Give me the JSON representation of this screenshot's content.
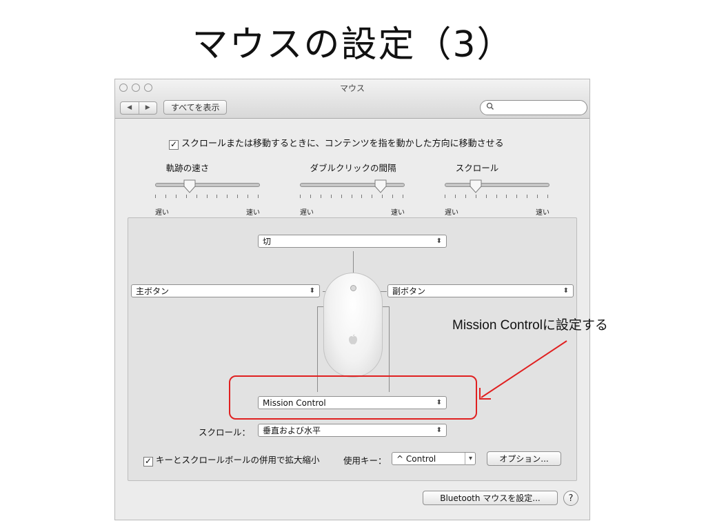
{
  "slide": {
    "title": "マウスの設定（3）"
  },
  "window": {
    "title": "マウス",
    "nav_back": "◀",
    "nav_forward": "▶",
    "show_all": "すべてを表示",
    "search_placeholder": ""
  },
  "natural_scroll": {
    "checked": true,
    "label": "スクロールまたは移動するときに、コンテンツを指を動かした方向に移動させる"
  },
  "sliders": [
    {
      "label": "軌跡の速さ",
      "min_label": "遅い",
      "max_label": "速い",
      "value": 0.33
    },
    {
      "label": "ダブルクリックの間隔",
      "min_label": "遅い",
      "max_label": "速い",
      "value": 0.78
    },
    {
      "label": "スクロール",
      "min_label": "遅い",
      "max_label": "速い",
      "value": 0.3
    }
  ],
  "buttons_config": {
    "top": "切",
    "left": "主ボタン",
    "right": "副ボタン",
    "bottom": "Mission Control",
    "scroll_label": "スクロール：",
    "scroll_value": "垂直および水平"
  },
  "zoom": {
    "checked": true,
    "label": "キーとスクロールボールの併用で拡大縮小",
    "key_label": "使用キー：",
    "key_value": "^ Control",
    "options_button": "オプション..."
  },
  "footer": {
    "bluetooth_button": "Bluetooth マウスを設定...",
    "help_button": "?"
  },
  "annotation": {
    "text": "Mission Controlに設定する",
    "color": "#e02020"
  }
}
